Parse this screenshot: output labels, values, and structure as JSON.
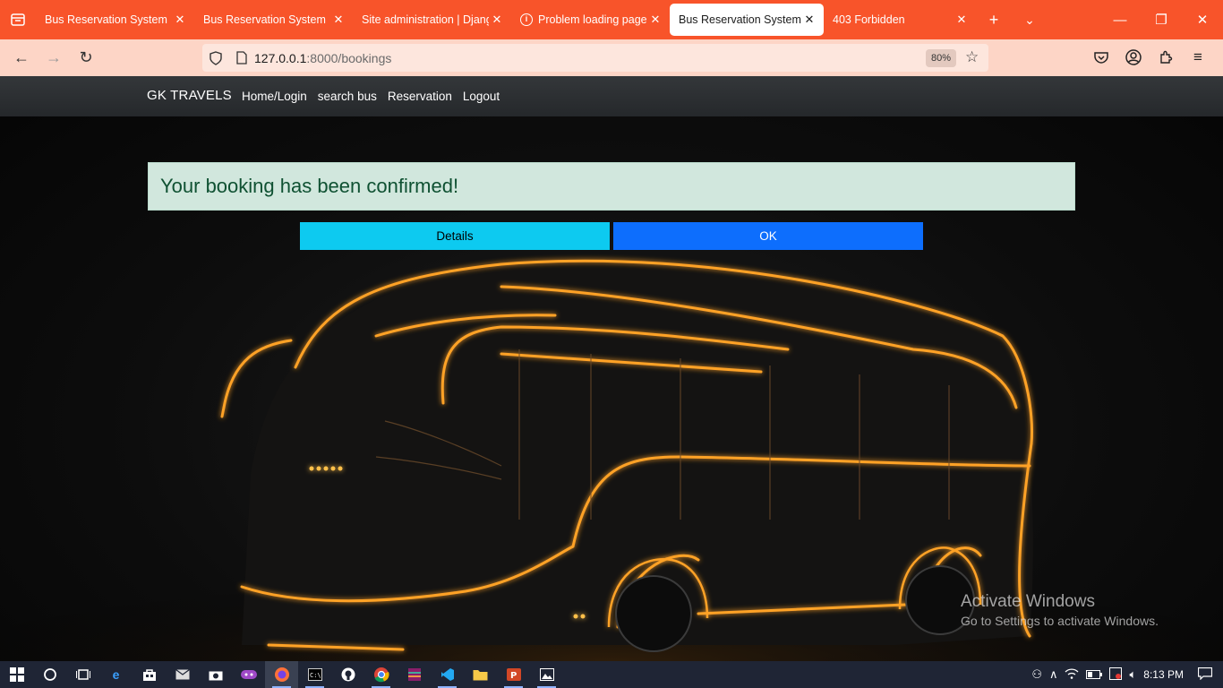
{
  "browser": {
    "tabs": [
      {
        "title": "Bus Reservation System in",
        "active": false
      },
      {
        "title": "Bus Reservation System in",
        "active": false
      },
      {
        "title": "Site administration | Djang",
        "active": false
      },
      {
        "title": "Problem loading page",
        "active": false
      },
      {
        "title": "Bus Reservation System in",
        "active": true
      },
      {
        "title": "403 Forbidden",
        "active": false
      }
    ],
    "url_host": "127.0.0.1",
    "url_path": ":8000/bookings",
    "zoom": "80%"
  },
  "site": {
    "brand": "GK TRAVELS",
    "nav": [
      "Home/Login",
      "search bus",
      "Reservation",
      "Logout"
    ],
    "alert": "Your booking has been confirmed!",
    "buttons": {
      "details": "Details",
      "ok": "OK"
    }
  },
  "watermark": {
    "title": "Activate Windows",
    "subtitle": "Go to Settings to activate Windows."
  },
  "taskbar": {
    "time": "8:13 PM"
  },
  "colors": {
    "tab_strip": "#f8542a",
    "nav_bar": "#fdd5c6",
    "alert_bg": "#d1e7dd",
    "btn_details": "#0dcaf0",
    "btn_ok": "#0d6efd",
    "neon": "#ff9a1f"
  }
}
